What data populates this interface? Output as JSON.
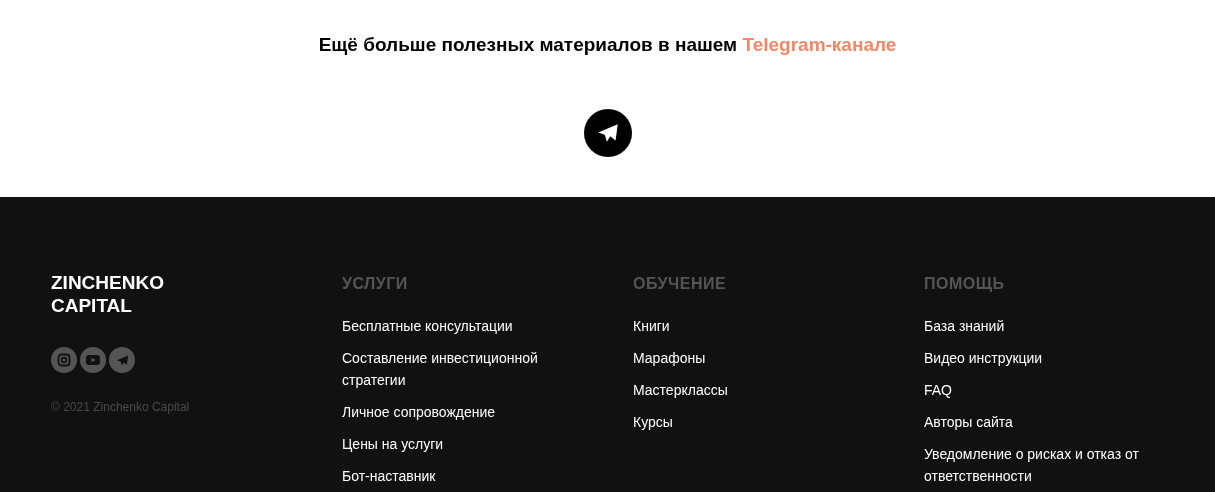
{
  "promo": {
    "text": "Ещё больше полезных материалов в нашем",
    "link": "Telegram-канале"
  },
  "footer": {
    "brand": [
      "ZINCHENKO",
      "CAPITAL"
    ],
    "copyright": "© 2021 Zinchenko Capital",
    "columns": [
      {
        "title": "УСЛУГИ",
        "links": [
          "Бесплатные консультации",
          "Составление инвестиционной стратегии",
          "Личное сопровождение",
          "Цены на услуги",
          "Бот-наставник"
        ]
      },
      {
        "title": "ОБУЧЕНИЕ",
        "links": [
          "Книги",
          "Марафоны",
          "Мастерклассы",
          "Курсы"
        ]
      },
      {
        "title": "ПОМОЩЬ",
        "links": [
          "База знаний",
          "Видео инструкции",
          "FAQ",
          "Авторы сайта",
          "Уведомление о рисках и отказ от ответственности"
        ]
      }
    ]
  }
}
